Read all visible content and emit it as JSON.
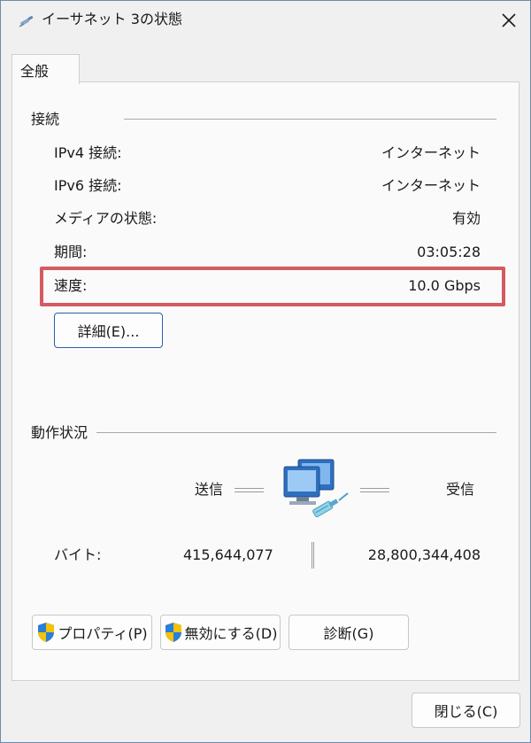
{
  "window": {
    "title": "イーサネット 3の状態",
    "close_glyph": "✕"
  },
  "tabs": [
    {
      "label": "全般"
    }
  ],
  "connection": {
    "title": "接続",
    "rows": [
      {
        "label": "IPv4 接続:",
        "value": "インターネット"
      },
      {
        "label": "IPv6 接続:",
        "value": "インターネット"
      },
      {
        "label": "メディアの状態:",
        "value": "有効"
      },
      {
        "label": "期間:",
        "value": "03:05:28"
      },
      {
        "label": "速度:",
        "value": "10.0 Gbps"
      }
    ],
    "details_button": "詳細(E)..."
  },
  "activity": {
    "title": "動作状況",
    "sent_label": "送信",
    "received_label": "受信",
    "bytes_label": "バイト:",
    "bytes_sent": "415,644,077",
    "bytes_received": "28,800,344,408"
  },
  "buttons": {
    "properties": "プロパティ(P)",
    "disable": "無効にする(D)",
    "diagnose": "診断(G)",
    "close": "閉じる(C)"
  },
  "colors": {
    "highlight": "#d45b60",
    "accent_border": "#2b5fa8",
    "shield_blue": "#2a7fd6",
    "shield_yellow": "#f5c20a"
  }
}
